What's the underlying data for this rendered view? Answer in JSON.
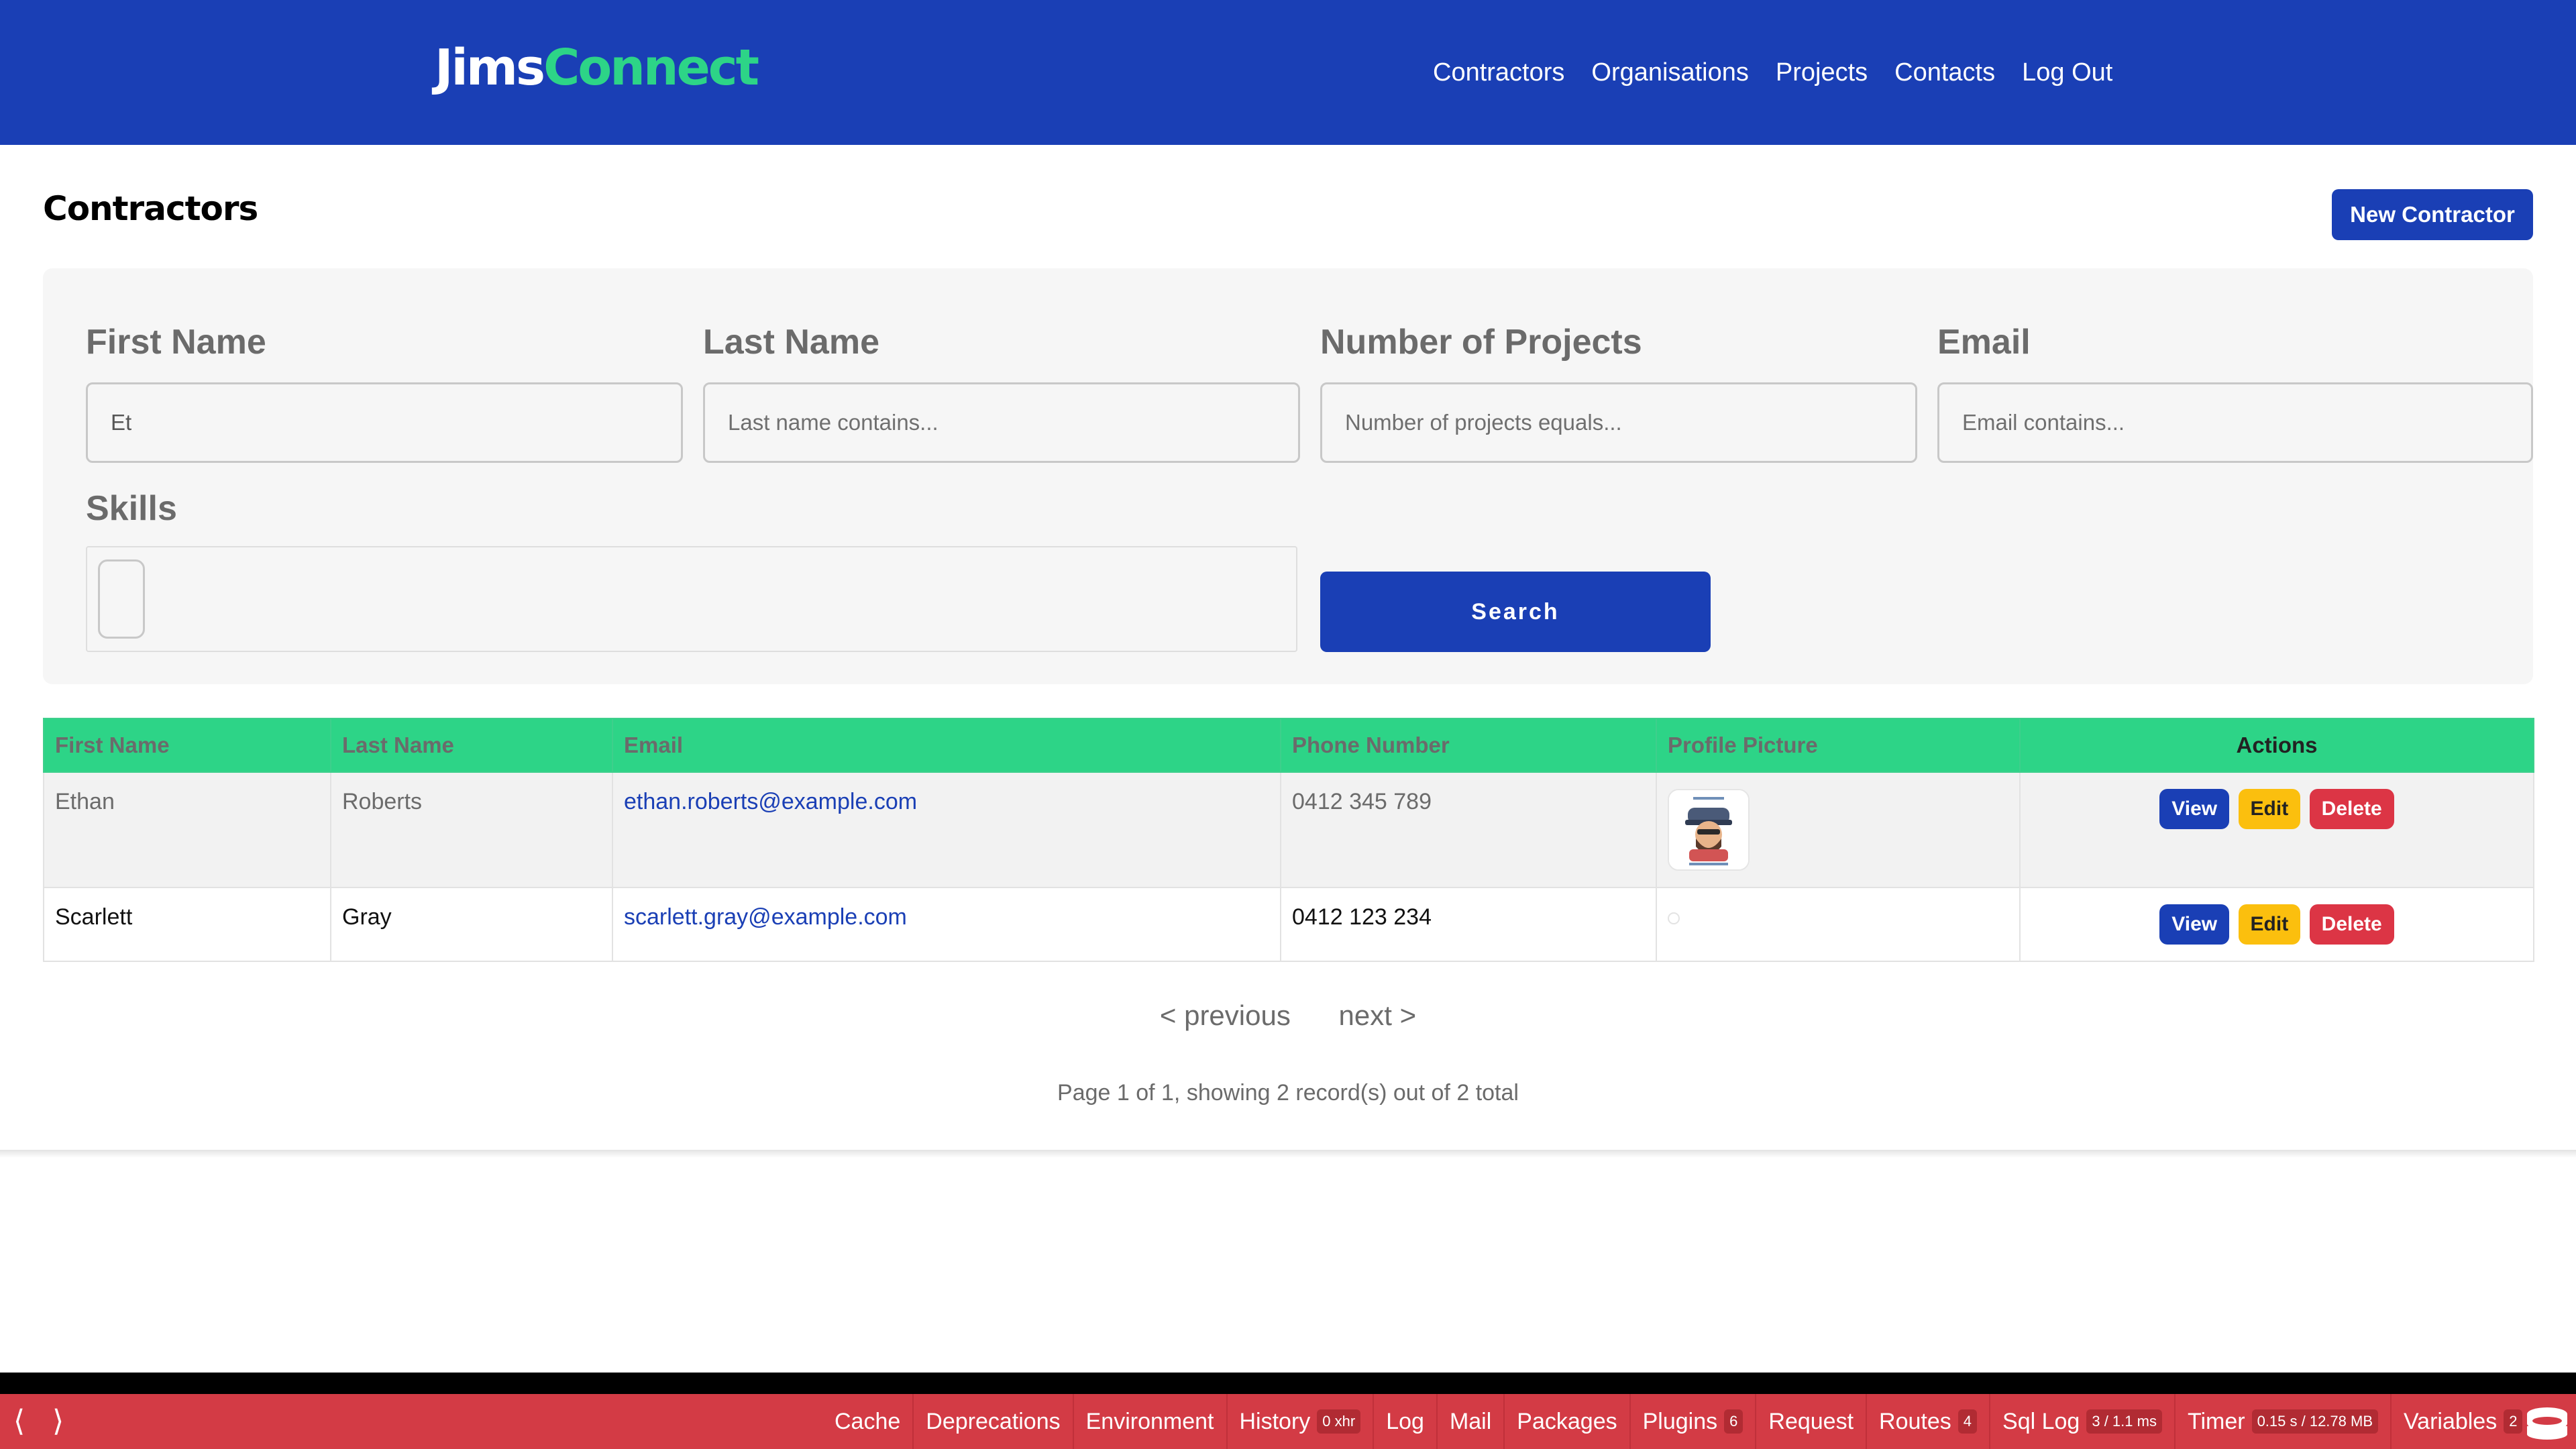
{
  "header": {
    "logo_part1": "Jims",
    "logo_part2": "Connect",
    "nav": [
      "Contractors",
      "Organisations",
      "Projects",
      "Contacts",
      "Log Out"
    ]
  },
  "page": {
    "title": "Contractors",
    "new_button": "New Contractor"
  },
  "filters": {
    "first_name": {
      "label": "First Name",
      "value": "Et",
      "placeholder": ""
    },
    "last_name": {
      "label": "Last Name",
      "value": "",
      "placeholder": "Last name contains..."
    },
    "num_projects": {
      "label": "Number of Projects",
      "value": "",
      "placeholder": "Number of projects equals..."
    },
    "email": {
      "label": "Email",
      "value": "",
      "placeholder": "Email contains..."
    },
    "skills": {
      "label": "Skills"
    },
    "search_button": "Search"
  },
  "table": {
    "columns": [
      "First Name",
      "Last Name",
      "Email",
      "Phone Number",
      "Profile Picture",
      "Actions"
    ],
    "rows": [
      {
        "first": "Ethan",
        "last": "Roberts",
        "email": "ethan.roberts@example.com",
        "phone": "0412 345 789",
        "picture": "spaghetti-and-meatballs-avatar"
      },
      {
        "first": "Scarlett",
        "last": "Gray",
        "email": "scarlett.gray@example.com",
        "phone": "0412 123 234",
        "picture": "none"
      }
    ],
    "actions": {
      "view": "View",
      "edit": "Edit",
      "delete": "Delete"
    }
  },
  "pagination": {
    "previous": "< previous",
    "next": "next >",
    "info": "Page 1 of 1, showing 2 record(s) out of 2 total"
  },
  "debug_bar": {
    "toggle_left": "⟨",
    "toggle_right": "⟩",
    "panels": [
      {
        "label": "Cache",
        "badge": ""
      },
      {
        "label": "Deprecations",
        "badge": ""
      },
      {
        "label": "Environment",
        "badge": ""
      },
      {
        "label": "History",
        "badge": "0 xhr"
      },
      {
        "label": "Log",
        "badge": ""
      },
      {
        "label": "Mail",
        "badge": ""
      },
      {
        "label": "Packages",
        "badge": ""
      },
      {
        "label": "Plugins",
        "badge": "6"
      },
      {
        "label": "Request",
        "badge": ""
      },
      {
        "label": "Routes",
        "badge": "4"
      },
      {
        "label": "Sql Log",
        "badge": "3 / 1.1 ms"
      },
      {
        "label": "Timer",
        "badge": "0.15 s / 12.78 MB"
      },
      {
        "label": "Variables",
        "badge": "2"
      }
    ]
  },
  "colors": {
    "primary": "#1a3fb5",
    "accent": "#2dd487",
    "warning": "#fbbf0e",
    "danger": "#dc3545",
    "debug_bar": "#d33b45"
  }
}
